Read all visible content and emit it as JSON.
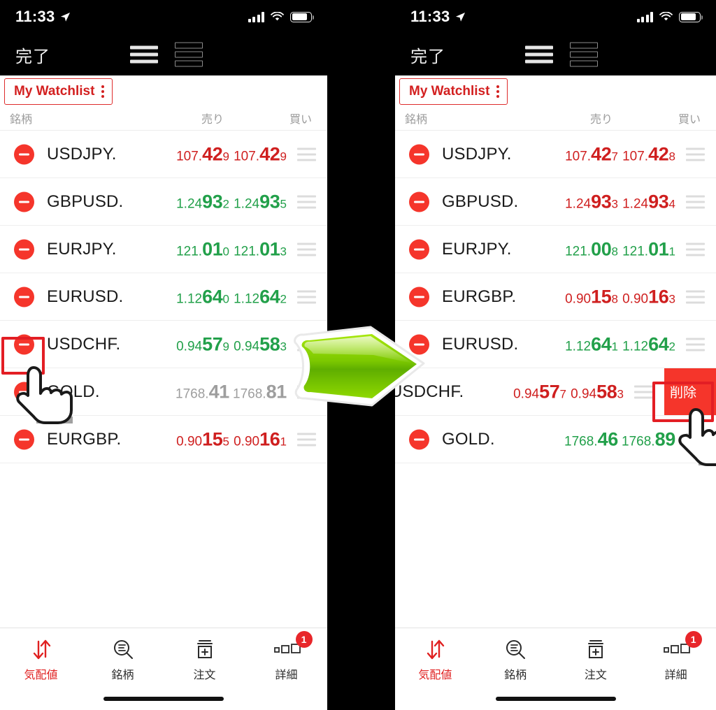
{
  "status_bar": {
    "time": "11:33",
    "location_icon": "location-arrow-icon",
    "signal_icon": "cellular-signal-icon",
    "wifi_icon": "wifi-icon",
    "battery_icon": "battery-icon"
  },
  "nav": {
    "done_label": "完了",
    "view_simple_icon": "list-view-simple-icon",
    "view_detail_icon": "list-view-detailed-icon"
  },
  "watchlist": {
    "name": "My Watchlist",
    "menu_icon": "kebab-menu-icon"
  },
  "columns": {
    "symbol": "銘柄",
    "sell": "売り",
    "buy": "買い"
  },
  "colors": {
    "up": "#22a04a",
    "down": "#cf1f1f",
    "flat": "#9e9e9e",
    "accent_red": "#f5352b",
    "brand_red": "#e02020",
    "annotation_red": "#e31e24",
    "arrow_green": "#86d305"
  },
  "left_panel": {
    "rows": [
      {
        "symbol": "USDJPY.",
        "sell": {
          "pre": "107.",
          "big": "42",
          "post": "9",
          "dir": "down"
        },
        "buy": {
          "pre": "107.",
          "big": "42",
          "post": "9",
          "dir": "down"
        }
      },
      {
        "symbol": "GBPUSD.",
        "sell": {
          "pre": "1.24",
          "big": "93",
          "post": "2",
          "dir": "up"
        },
        "buy": {
          "pre": "1.24",
          "big": "93",
          "post": "5",
          "dir": "up"
        }
      },
      {
        "symbol": "EURJPY.",
        "sell": {
          "pre": "121.",
          "big": "01",
          "post": "0",
          "dir": "up"
        },
        "buy": {
          "pre": "121.",
          "big": "01",
          "post": "3",
          "dir": "up"
        }
      },
      {
        "symbol": "EURUSD.",
        "sell": {
          "pre": "1.12",
          "big": "64",
          "post": "0",
          "dir": "up"
        },
        "buy": {
          "pre": "1.12",
          "big": "64",
          "post": "2",
          "dir": "up"
        }
      },
      {
        "symbol": "USDCHF.",
        "sell": {
          "pre": "0.94",
          "big": "57",
          "post": "9",
          "dir": "up"
        },
        "buy": {
          "pre": "0.94",
          "big": "58",
          "post": "3",
          "dir": "up"
        }
      },
      {
        "symbol": "GOLD.",
        "sell": {
          "pre": "1768.",
          "big": "41",
          "post": "",
          "dir": "flat"
        },
        "buy": {
          "pre": "1768.",
          "big": "81",
          "post": "",
          "dir": "flat"
        }
      },
      {
        "symbol": "EURGBP.",
        "sell": {
          "pre": "0.90",
          "big": "15",
          "post": "5",
          "dir": "down"
        },
        "buy": {
          "pre": "0.90",
          "big": "16",
          "post": "1",
          "dir": "down"
        }
      }
    ],
    "highlight_target": "remove-button-usdchf",
    "cursor": "pointing-hand-cursor"
  },
  "right_panel": {
    "rows": [
      {
        "symbol": "USDJPY.",
        "sell": {
          "pre": "107.",
          "big": "42",
          "post": "7",
          "dir": "down"
        },
        "buy": {
          "pre": "107.",
          "big": "42",
          "post": "8",
          "dir": "down"
        },
        "swiped": false
      },
      {
        "symbol": "GBPUSD.",
        "sell": {
          "pre": "1.24",
          "big": "93",
          "post": "3",
          "dir": "down"
        },
        "buy": {
          "pre": "1.24",
          "big": "93",
          "post": "4",
          "dir": "down"
        },
        "swiped": false
      },
      {
        "symbol": "EURJPY.",
        "sell": {
          "pre": "121.",
          "big": "00",
          "post": "8",
          "dir": "up"
        },
        "buy": {
          "pre": "121.",
          "big": "01",
          "post": "1",
          "dir": "up"
        },
        "swiped": false
      },
      {
        "symbol": "EURGBP.",
        "sell": {
          "pre": "0.90",
          "big": "15",
          "post": "8",
          "dir": "down"
        },
        "buy": {
          "pre": "0.90",
          "big": "16",
          "post": "3",
          "dir": "down"
        },
        "swiped": false
      },
      {
        "symbol": "EURUSD.",
        "sell": {
          "pre": "1.12",
          "big": "64",
          "post": "1",
          "dir": "up"
        },
        "buy": {
          "pre": "1.12",
          "big": "64",
          "post": "2",
          "dir": "up"
        },
        "swiped": false
      },
      {
        "symbol": "USDCHF.",
        "sell": {
          "pre": "0.94",
          "big": "57",
          "post": "7",
          "dir": "down"
        },
        "buy": {
          "pre": "0.94",
          "big": "58",
          "post": "3",
          "dir": "down"
        },
        "swiped": true
      },
      {
        "symbol": "GOLD.",
        "sell": {
          "pre": "1768.",
          "big": "46",
          "post": "",
          "dir": "up"
        },
        "buy": {
          "pre": "1768.",
          "big": "89",
          "post": "",
          "dir": "up"
        },
        "swiped": false
      }
    ],
    "delete_label": "削除",
    "highlight_target": "delete-button-usdchf",
    "cursor": "pointing-hand-cursor"
  },
  "tab_bar": {
    "tabs": [
      {
        "label": "気配値",
        "icon": "quotes-arrows-icon",
        "active": true,
        "badge": ""
      },
      {
        "label": "銘柄",
        "icon": "symbols-search-icon",
        "active": false,
        "badge": ""
      },
      {
        "label": "注文",
        "icon": "orders-add-icon",
        "active": false,
        "badge": ""
      },
      {
        "label": "詳細",
        "icon": "details-squares-icon",
        "active": false,
        "badge": "1"
      }
    ]
  },
  "annotation": {
    "arrow_icon": "green-right-arrow"
  }
}
